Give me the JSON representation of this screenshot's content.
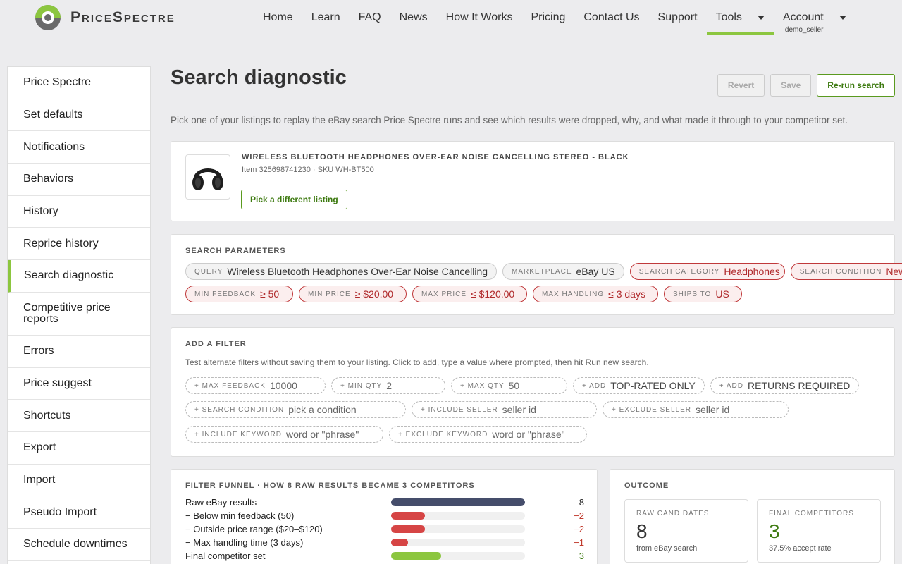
{
  "brand": {
    "name": "PriceSpectre",
    "accent": "#8cc63f"
  },
  "nav": {
    "items": [
      "Home",
      "Learn",
      "FAQ",
      "News",
      "How It Works",
      "Pricing",
      "Contact Us",
      "Support"
    ],
    "tools": "Tools",
    "account": "Account",
    "account_user": "demo_seller"
  },
  "sidebar": {
    "items": [
      "Price Spectre",
      "Set defaults",
      "Notifications",
      "Behaviors",
      "History",
      "Reprice history",
      "Search diagnostic",
      "Competitive price reports",
      "Errors",
      "Price suggest",
      "Shortcuts",
      "Export",
      "Import",
      "Pseudo Import",
      "Schedule downtimes"
    ],
    "active": "Search diagnostic"
  },
  "page": {
    "title": "Search diagnostic",
    "intro": "Pick one of your listings to replay the eBay search Price Spectre runs and see which results were dropped, why, and what made it through to your competitor set.",
    "buttons": {
      "revert": "Revert",
      "save": "Save",
      "rerun": "Re-run search"
    }
  },
  "listing": {
    "title": "WIRELESS BLUETOOTH HEADPHONES OVER-EAR NOISE CANCELLING STEREO - BLACK",
    "meta": "Item 325698741230 · SKU WH-BT500",
    "pick_label": "Pick a different listing",
    "thumb_icon": "headphones-icon"
  },
  "search_params": {
    "label": "SEARCH PARAMETERS",
    "chips": [
      {
        "k": "QUERY",
        "v": "Wireless Bluetooth Headphones Over-Ear Noise Cancelling",
        "red": false
      },
      {
        "k": "MARKETPLACE",
        "v": "eBay US",
        "red": false
      },
      {
        "k": "SEARCH CATEGORY",
        "v": "Headphones",
        "red": true
      },
      {
        "k": "SEARCH CONDITION",
        "v": "New",
        "red": true
      },
      {
        "k": "MIN FEEDBACK",
        "v": "≥ 50",
        "red": true
      },
      {
        "k": "MIN PRICE",
        "v": "≥ $20.00",
        "red": true
      },
      {
        "k": "MAX PRICE",
        "v": "≤ $120.00",
        "red": true
      },
      {
        "k": "MAX HANDLING",
        "v": "≤ 3 days",
        "red": true
      },
      {
        "k": "SHIPS TO",
        "v": "US",
        "red": true
      }
    ]
  },
  "add_filter": {
    "label": "ADD A FILTER",
    "help": "Test alternate filters without saving them to your listing. Click to add, type a value where prompted, then hit Run new search.",
    "chips": [
      {
        "k": "+ MAX FEEDBACK",
        "v": "10000"
      },
      {
        "k": "+ MIN QTY",
        "v": "2"
      },
      {
        "k": "+ MAX QTY",
        "v": "50"
      },
      {
        "k": "+ ADD",
        "v": "TOP-RATED ONLY"
      },
      {
        "k": "+ ADD",
        "v": "RETURNS REQUIRED"
      },
      {
        "k": "+ SEARCH CONDITION",
        "v": "pick a condition"
      },
      {
        "k": "+ INCLUDE SELLER",
        "v": "seller id"
      },
      {
        "k": "+ EXCLUDE SELLER",
        "v": "seller id"
      },
      {
        "k": "+ INCLUDE KEYWORD",
        "v": "word or \"phrase\""
      },
      {
        "k": "+ EXCLUDE KEYWORD",
        "v": "word or \"phrase\""
      }
    ]
  },
  "funnel": {
    "label": "FILTER FUNNEL · HOW 8 RAW RESULTS BECAME 3 COMPETITORS",
    "rows": [
      {
        "label": "Raw eBay results",
        "value": "8",
        "fraction": 1.0,
        "color": "#454d6b",
        "num_color": "#222"
      },
      {
        "label": "− Below min feedback (50)",
        "value": "−2",
        "fraction": 0.25,
        "color": "#d64545",
        "num_color": "#c0392b"
      },
      {
        "label": "− Outside price range ($20–$120)",
        "value": "−2",
        "fraction": 0.25,
        "color": "#d64545",
        "num_color": "#c0392b"
      },
      {
        "label": "− Max handling time (3 days)",
        "value": "−1",
        "fraction": 0.125,
        "color": "#d64545",
        "num_color": "#c0392b"
      },
      {
        "label": "Final competitor set",
        "value": "3",
        "fraction": 0.375,
        "color": "#8cc63f",
        "num_color": "#3d7a10"
      }
    ]
  },
  "outcome": {
    "label": "OUTCOME",
    "raw": {
      "label": "RAW CANDIDATES",
      "value": "8",
      "sub": "from eBay search"
    },
    "final": {
      "label": "FINAL COMPETITORS",
      "value": "3",
      "sub": "37.5% accept rate"
    }
  }
}
